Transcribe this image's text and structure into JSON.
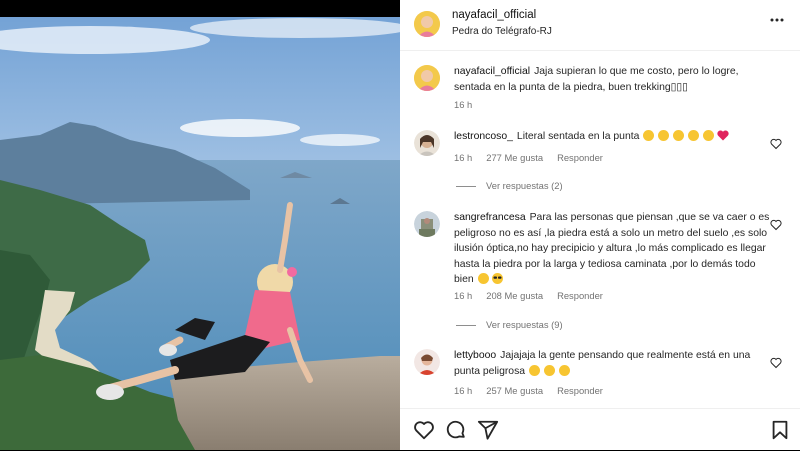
{
  "post": {
    "username": "nayafacil_official",
    "location": "Pedra do Telégrafo-RJ",
    "caption": "Jaja supieran lo que me costo, pero lo logre, sentada en la punta de la piedra, buen trekking▯▯▯",
    "caption_time": "16 h"
  },
  "comments": [
    {
      "username": "lestroncoso_",
      "text": "Literal sentada en la punta",
      "emojis": [
        "laugh",
        "laugh",
        "laugh",
        "laugh",
        "laugh",
        "red-heart"
      ],
      "time": "16 h",
      "likes": "277 Me gusta",
      "reply": "Responder",
      "view_replies": "Ver respuestas (2)"
    },
    {
      "username": "sangrefrancesa",
      "text": "Para las personas que piensan ,que se va caer o es peligroso no es así ,la piedra está a solo un metro del suelo ,es solo ilusión óptica,no hay precipicio y altura ,lo más complicado es llegar hasta la piedra por la larga y tediosa caminata ,por lo demás todo bien",
      "emojis": [
        "smirk",
        "sunglasses"
      ],
      "time": "16 h",
      "likes": "208 Me gusta",
      "reply": "Responder",
      "view_replies": "Ver respuestas (9)"
    },
    {
      "username": "lettybooo",
      "text": "Jajajaja la gente pensando que realmente está en una punta peligrosa",
      "emojis": [
        "laugh",
        "laugh",
        "laugh"
      ],
      "time": "16 h",
      "likes": "257 Me gusta",
      "reply": "Responder"
    }
  ],
  "colors": {
    "text": "#262626",
    "secondary": "#737373",
    "border": "#efefef",
    "heart_red": "#e0245e",
    "emoji_yellow": "#f7c531"
  },
  "icons": {
    "footer": [
      "heart-icon",
      "comment-icon",
      "share-icon",
      "bookmark-icon"
    ],
    "header": "more-options-icon"
  }
}
